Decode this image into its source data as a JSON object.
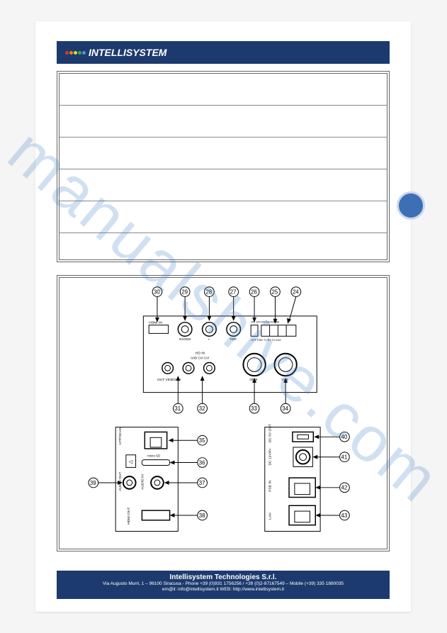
{
  "brand": {
    "name": "INTELLISYSTEM"
  },
  "watermark": "manualshive.com",
  "chart_data": {
    "type": "table",
    "rows": [
      "",
      "",
      "",
      "",
      "",
      ""
    ]
  },
  "diagram": {
    "top_panel_callouts": [
      "30",
      "29",
      "28",
      "27",
      "26",
      "25",
      "24",
      "31",
      "32",
      "33",
      "34"
    ],
    "top_panel_labels": {
      "hdmi_in": "HDMI IN",
      "ex_sdi": "EX/SDI",
      "plus": "+",
      "tdr": "TDR",
      "switch": "ON 12V  RS232  RS485",
      "switch_pos": "OFF PSE  T1 R1 T2 G42",
      "hd_in": "HD IN",
      "ahd_cvi": "AHD CVI CVI",
      "cvbs_out": "OUT  VIDEO  IN",
      "opm": "OPM",
      "vls": "VLS"
    },
    "left_panel_callouts": [
      "35",
      "36",
      "37",
      "38",
      "39"
    ],
    "left_panel_labels": {
      "utp": "UTP/SCAN",
      "micro_sd": "micro SD",
      "audio_in": "AUDIO IN",
      "audio_out": "AUDIO OUT",
      "hdmi_out": "HDMI OUT"
    },
    "right_panel_callouts": [
      "40",
      "41",
      "42",
      "43"
    ],
    "right_panel_labels": {
      "dc5v": "DC 5V OUT",
      "dc12v": "DC 12V/IN",
      "pse_in": "PSE IN",
      "lan": "LAN"
    }
  },
  "footer": {
    "company": "Intellisystem Technologies S.r.l.",
    "address": "Via Augusto Murri, 1 – 96100 Siracusa - Phone +39 (0)931 1756256 / +39 (0)2-87167549 – Mobile (+39) 335 1880035",
    "contact": "em@il: info@intellisystem.it WEB: http://www.intellisystem.it"
  }
}
